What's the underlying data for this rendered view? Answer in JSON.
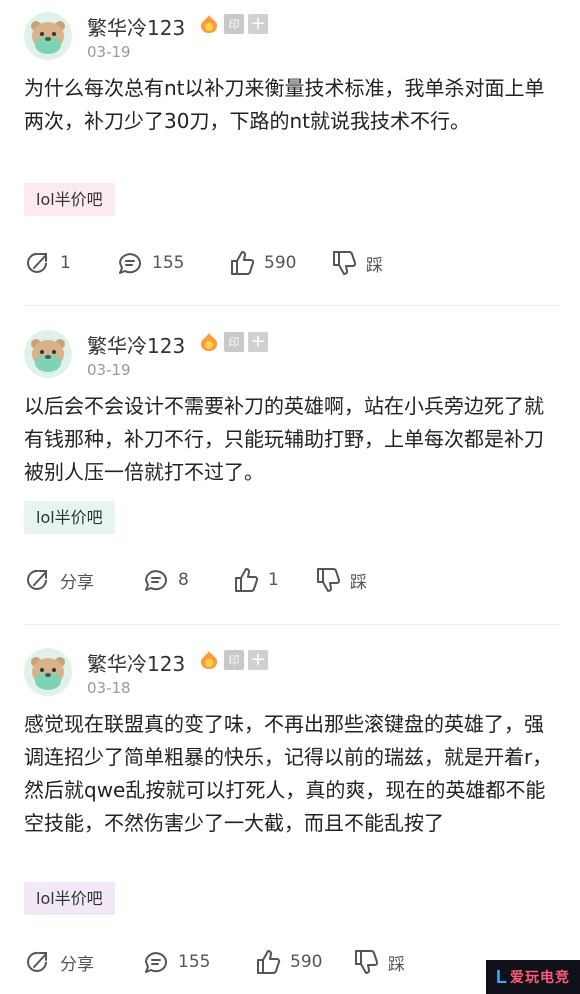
{
  "posts": [
    {
      "username": "繁华冷123",
      "stamp_label": "印",
      "plus_label": "+",
      "date": "03-19",
      "content": "为什么每次总有nt以补刀来衡量技术标准，我单杀对面上单两次，补刀少了30刀，下路的nt就说我技术不行。",
      "tag": "lol半价吧",
      "tag_bg": "#fbeaf0",
      "share_label": "1",
      "comments": "155",
      "likes": "590",
      "dislike_label": "踩"
    },
    {
      "username": "繁华冷123",
      "stamp_label": "印",
      "plus_label": "+",
      "date": "03-19",
      "content": "以后会不会设计不需要补刀的英雄啊，站在小兵旁边死了就有钱那种，补刀不行，只能玩辅助打野，上单每次都是补刀被别人压一倍就打不过了。",
      "tag": "lol半价吧",
      "tag_bg": "#e6f6ef",
      "share_label": "分享",
      "comments": "8",
      "likes": "1",
      "dislike_label": "踩"
    },
    {
      "username": "繁华冷123",
      "stamp_label": "印",
      "plus_label": "+",
      "date": "03-18",
      "content": "感觉现在联盟真的变了味，不再出那些滚键盘的英雄了，强调连招少了简单粗暴的快乐，记得以前的瑞兹，就是开着r，然后就qwe乱按就可以打死人，真的爽，现在的英雄都不能空技能，不然伤害少了一大截，而且不能乱按了",
      "tag": "lol半价吧",
      "tag_bg": "#f2e8f6",
      "share_label": "分享",
      "comments": "155",
      "likes": "590",
      "dislike_label": "踩"
    }
  ],
  "watermark": {
    "letter": "L",
    "text": "爱玩电竞"
  }
}
